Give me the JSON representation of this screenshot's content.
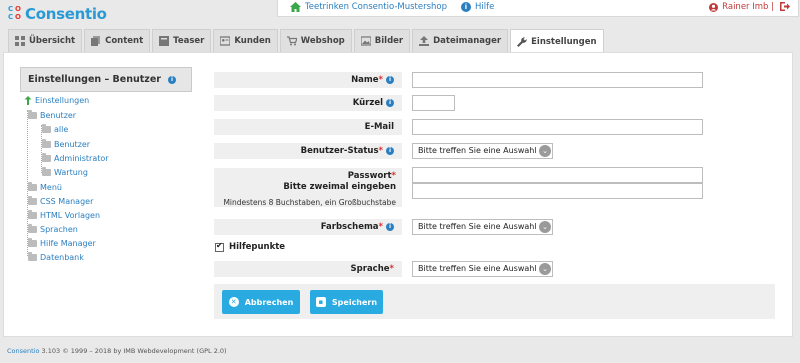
{
  "logo": {
    "text": "Consentio",
    "mark_letters": [
      "C",
      "O",
      "C",
      "O"
    ]
  },
  "topbar": {
    "shop_label": "Teetrinken Consentio-Mustershop",
    "help_label": "Hilfe",
    "user_label": "Rainer Imb |"
  },
  "tabs": [
    {
      "label": "Übersicht",
      "icon": "grid-icon"
    },
    {
      "label": "Content",
      "icon": "pages-icon"
    },
    {
      "label": "Teaser",
      "icon": "teaser-icon"
    },
    {
      "label": "Kunden",
      "icon": "contact-card-icon"
    },
    {
      "label": "Webshop",
      "icon": "cart-icon"
    },
    {
      "label": "Bilder",
      "icon": "images-icon"
    },
    {
      "label": "Dateimanager",
      "icon": "upload-icon"
    },
    {
      "label": "Einstellungen",
      "icon": "wrench-icon",
      "active": true
    }
  ],
  "sidebar": {
    "title": "Einstellungen – Benutzer",
    "tree": {
      "root": "Einstellungen",
      "benutzer": "Benutzer",
      "benutzer_children": [
        "alle",
        "Benutzer",
        "Administrator",
        "Wartung"
      ],
      "others": [
        "Menü",
        "CSS Manager",
        "HTML Vorlagen",
        "Sprachen",
        "Hilfe Manager",
        "Datenbank"
      ]
    }
  },
  "form": {
    "name_label": "Name",
    "kuerzel_label": "Kürzel",
    "email_label": "E-Mail",
    "status_label": "Benutzer-Status",
    "status_value": "Bitte treffen Sie eine Auswahl",
    "password_label": "Passwort",
    "password_hint1": "Bitte zweimal eingeben",
    "password_hint2": "Mindestens 8 Buchstaben, ein Großbuchstabe",
    "farbschema_label": "Farbschema",
    "farbschema_value": "Bitte treffen Sie eine Auswahl",
    "hilfepunkte_label": "Hilfepunkte",
    "sprache_label": "Sprache",
    "sprache_value": "Bitte treffen Sie eine Auswahl",
    "required_mark": "*"
  },
  "buttons": {
    "cancel": "Abbrechen",
    "save": "Speichern"
  },
  "footer": {
    "brand": "Consentio",
    "text": " 3.103 © 1999 – 2018 by IMB Webdevelopment (GPL 2.0)"
  },
  "colors": {
    "accent": "#2a9ad7",
    "button": "#29abe2",
    "required": "#d9302c",
    "logout": "#c03a3a"
  }
}
